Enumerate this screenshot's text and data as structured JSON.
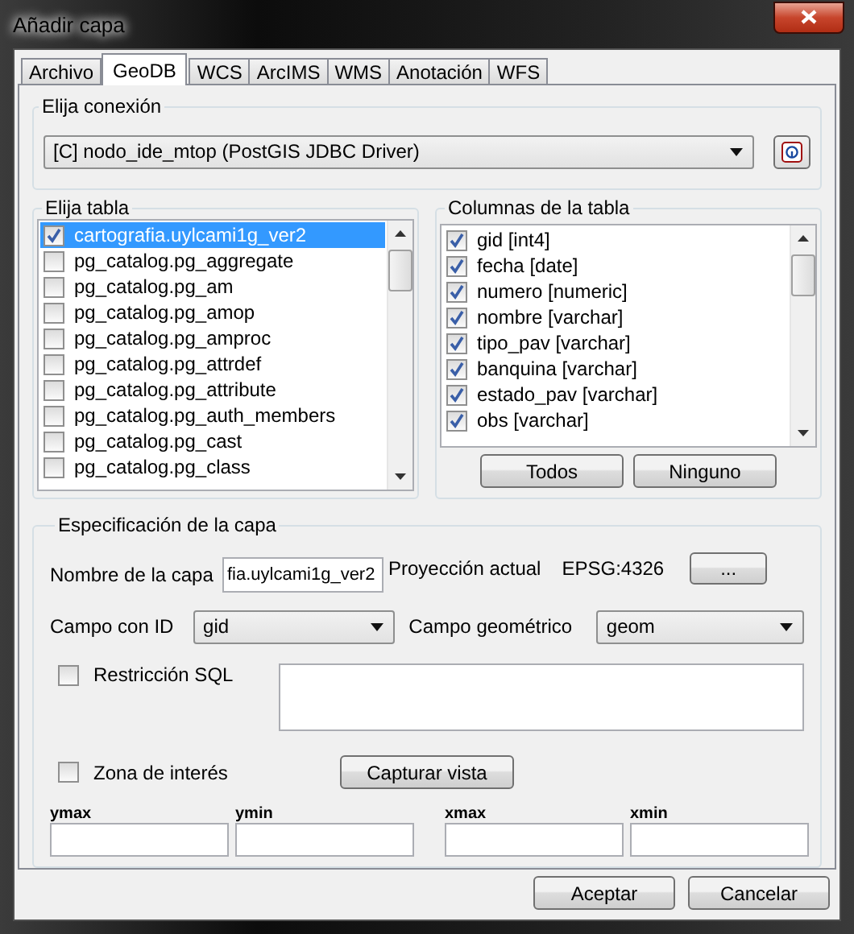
{
  "window": {
    "title": "Añadir capa"
  },
  "tabs": [
    {
      "label": "Archivo",
      "selected": false
    },
    {
      "label": "GeoDB",
      "selected": true
    },
    {
      "label": "WCS",
      "selected": false
    },
    {
      "label": "ArcIMS",
      "selected": false
    },
    {
      "label": "WMS",
      "selected": false
    },
    {
      "label": "Anotación",
      "selected": false
    },
    {
      "label": "WFS",
      "selected": false
    }
  ],
  "connection": {
    "label": "Elija conexión",
    "value": "[C] nodo_ide_mtop (PostGIS JDBC Driver)"
  },
  "tables": {
    "label": "Elija tabla",
    "items": [
      {
        "name": "cartografia.uylcami1g_ver2",
        "checked": true,
        "selected": true
      },
      {
        "name": "pg_catalog.pg_aggregate",
        "checked": false,
        "selected": false
      },
      {
        "name": "pg_catalog.pg_am",
        "checked": false,
        "selected": false
      },
      {
        "name": "pg_catalog.pg_amop",
        "checked": false,
        "selected": false
      },
      {
        "name": "pg_catalog.pg_amproc",
        "checked": false,
        "selected": false
      },
      {
        "name": "pg_catalog.pg_attrdef",
        "checked": false,
        "selected": false
      },
      {
        "name": "pg_catalog.pg_attribute",
        "checked": false,
        "selected": false
      },
      {
        "name": "pg_catalog.pg_auth_members",
        "checked": false,
        "selected": false
      },
      {
        "name": "pg_catalog.pg_cast",
        "checked": false,
        "selected": false
      },
      {
        "name": "pg_catalog.pg_class",
        "checked": false,
        "selected": false
      }
    ]
  },
  "columns": {
    "label": "Columnas de la tabla",
    "items": [
      {
        "name": "gid [int4]",
        "checked": true
      },
      {
        "name": "fecha [date]",
        "checked": true
      },
      {
        "name": "numero [numeric]",
        "checked": true
      },
      {
        "name": "nombre [varchar]",
        "checked": true
      },
      {
        "name": "tipo_pav [varchar]",
        "checked": true
      },
      {
        "name": "banquina [varchar]",
        "checked": true
      },
      {
        "name": "estado_pav [varchar]",
        "checked": true
      },
      {
        "name": "obs [varchar]",
        "checked": true
      }
    ],
    "buttons": [
      "Todos",
      "Ninguno"
    ]
  },
  "layer_spec": {
    "label": "Especificación de la capa",
    "name_label": "Nombre de la capa",
    "name_value": "fia.uylcami1g_ver2",
    "projection_label": "Proyección actual",
    "projection_value": "EPSG:4326",
    "projection_button": "...",
    "id_field_label": "Campo con ID",
    "id_field_value": "gid",
    "geom_field_label": "Campo geométrico",
    "geom_field_value": "geom",
    "sql": {
      "label": "Restricción SQL",
      "checked": false
    },
    "zone": {
      "label": "Zona de interés",
      "checked": false,
      "button": "Capturar vista"
    },
    "extent": [
      {
        "label": "ymax"
      },
      {
        "label": "ymin"
      },
      {
        "label": "xmax"
      },
      {
        "label": "xmin"
      }
    ]
  },
  "buttons": [
    "Aceptar",
    "Cancelar"
  ]
}
